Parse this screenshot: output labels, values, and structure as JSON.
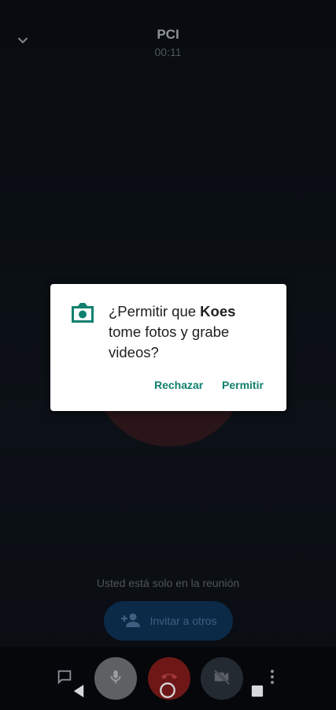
{
  "header": {
    "title": "PCI",
    "timer": "00:11"
  },
  "call": {
    "alone_message": "Usted está solo en la reunión",
    "invite_label": "Invitar a otros"
  },
  "dialog": {
    "question_prefix": "¿Permitir que ",
    "app_name": "Koes",
    "question_suffix": " tome fotos y grabe videos?",
    "deny_label": "Rechazar",
    "allow_label": "Permitir",
    "icon": "camera-icon"
  },
  "toolbar": {
    "icons": [
      "chat-icon",
      "mic-icon",
      "hangup-icon",
      "camera-off-icon",
      "more-vert-icon"
    ]
  },
  "navbar": {
    "icons": [
      "back-icon",
      "home-icon",
      "recents-icon"
    ]
  },
  "colors": {
    "accent_teal": "#11806f",
    "hangup_red": "#6e1717",
    "invite_blue": "#0b2a48",
    "scrim_background": "#0a0e13"
  }
}
